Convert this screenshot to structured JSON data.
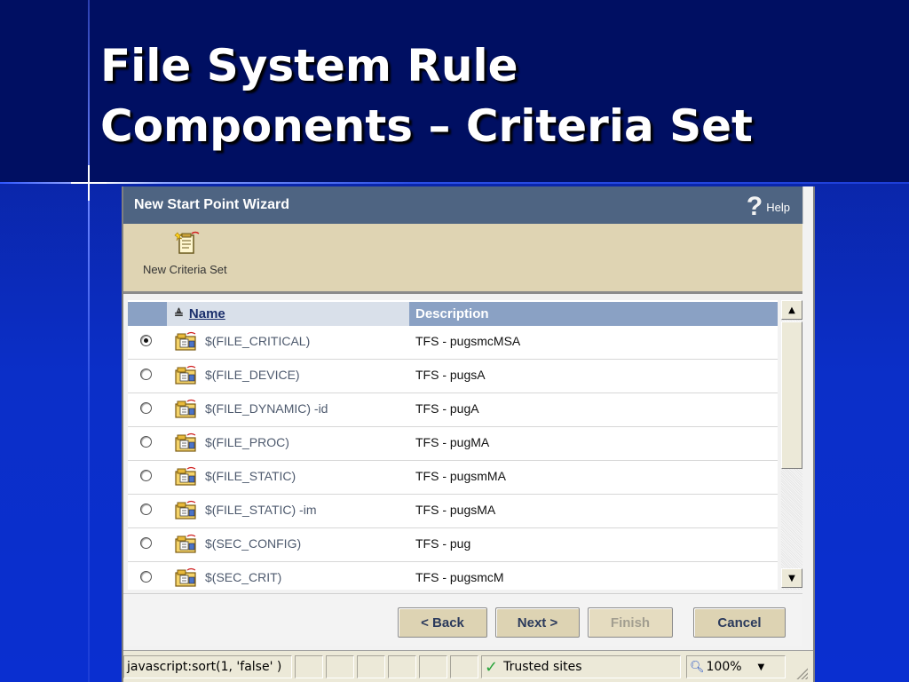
{
  "slide": {
    "title_line1": "File System Rule",
    "title_line2": "Components – Criteria Set"
  },
  "wizard": {
    "title": "New Start Point Wizard",
    "help_label": "Help",
    "toolbar": {
      "new_criteria_label": "New Criteria Set",
      "new_criteria_icon": "new-criteria-set-icon"
    },
    "table": {
      "columns": {
        "name": "Name",
        "description": "Description"
      },
      "rows": [
        {
          "name": "$(FILE_CRITICAL)",
          "description": "TFS - pugsmcMSA",
          "selected": true
        },
        {
          "name": "$(FILE_DEVICE)",
          "description": "TFS - pugsA",
          "selected": false
        },
        {
          "name": "$(FILE_DYNAMIC) -id",
          "description": "TFS - pugA",
          "selected": false
        },
        {
          "name": "$(FILE_PROC)",
          "description": "TFS - pugMA",
          "selected": false
        },
        {
          "name": "$(FILE_STATIC)",
          "description": "TFS - pugsmMA",
          "selected": false
        },
        {
          "name": "$(FILE_STATIC) -im",
          "description": "TFS - pugsMA",
          "selected": false
        },
        {
          "name": "$(SEC_CONFIG)",
          "description": "TFS - pug",
          "selected": false
        },
        {
          "name": "$(SEC_CRIT)",
          "description": "TFS - pugsmcM",
          "selected": false
        }
      ]
    },
    "buttons": {
      "back": "< Back",
      "next": "Next >",
      "finish": "Finish",
      "cancel": "Cancel"
    }
  },
  "statusbar": {
    "url_text": "javascript:sort(1, 'false' )",
    "zone": "Trusted sites",
    "zoom": "100%"
  },
  "colors": {
    "slide_bg": "#0b2fc8",
    "title_band": "#000f62",
    "wizard_header": "#4e6482",
    "toolbar_bg": "#dfd4b3",
    "grid_header": "#8aa1c4"
  }
}
